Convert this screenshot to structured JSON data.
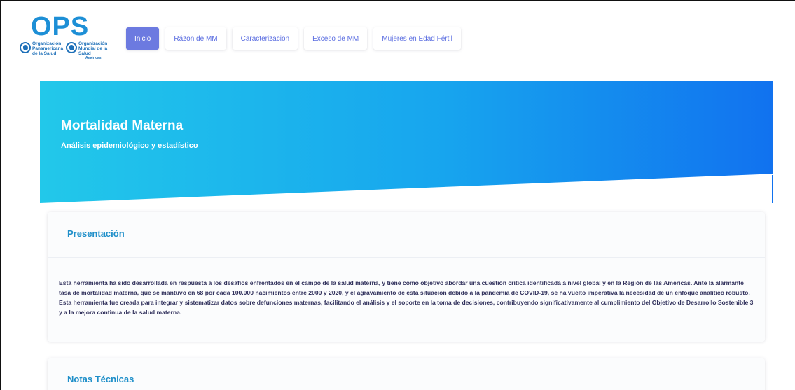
{
  "brand": {
    "logo_text": "OPS",
    "org_left_lines": [
      "Organización",
      "Panamericana",
      "de la Salud"
    ],
    "org_right_lines": [
      "Organización",
      "Mundial de la Salud"
    ],
    "org_right_region": "Américas"
  },
  "nav": {
    "items": [
      {
        "label": "Inicio",
        "active": true
      },
      {
        "label": "Rázon de MM",
        "active": false
      },
      {
        "label": "Caracterización",
        "active": false
      },
      {
        "label": "Exceso de MM",
        "active": false
      },
      {
        "label": "Mujeres en Edad Fértil",
        "active": false
      }
    ]
  },
  "hero": {
    "title": "Mortalidad Materna",
    "subtitle": "Análisis epidemiológico y estadístico"
  },
  "presentation": {
    "title": "Presentación",
    "body": "Esta herramienta ha sido desarrollada en respuesta a los desafíos enfrentados en el campo de la salud materna, y tiene como objetivo abordar una cuestión crítica identificada a nivel global y en la Región de las Américas. Ante la alarmante tasa de mortalidad materna, que se mantuvo en 68 por cada 100.000 nacimientos entre 2000 y 2020, y el agravamiento de esta situación debido a la pandemia de COVID-19, se ha vuelto imperativa la necesidad de un enfoque analítico robusto. Esta herramienta fue creada para integrar y sistematizar datos sobre defunciones maternas, facilitando el análisis y el soporte en la toma de decisiones, contribuyendo significativamente al cumplimiento del Objetivo de Desarrollo Sostenible 3 y a la mejora continua de la salud materna."
  },
  "technical_notes": {
    "title": "Notas Técnicas"
  },
  "colors": {
    "accent": "#6c7ae0",
    "brand_blue": "#1d8fd6",
    "hero_start": "#22c8ea",
    "hero_end": "#1172ef",
    "card_title": "#1f8fc9"
  }
}
